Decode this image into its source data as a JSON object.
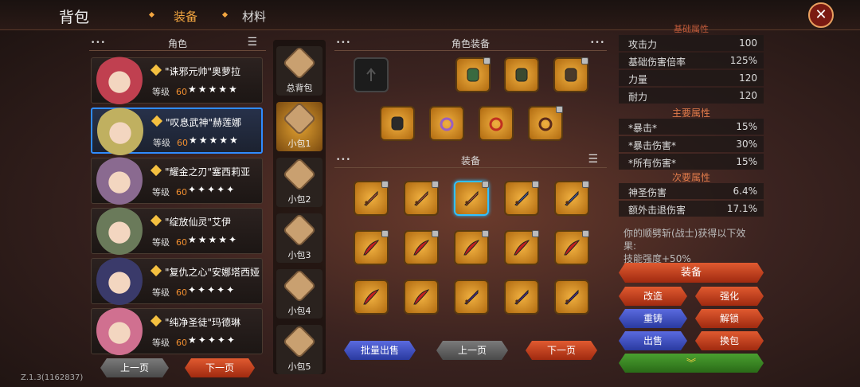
{
  "header": {
    "title": "背包",
    "tabs": [
      "装备",
      "材料"
    ]
  },
  "characters_header": "角色",
  "characters": [
    {
      "name": "\"诛邪元帅\"奥萝拉",
      "level_label": "等级",
      "level": "60",
      "stars": "★★★★★",
      "hue": "#c04050"
    },
    {
      "name": "\"叹息武神\"赫莲娜",
      "level_label": "等级",
      "level": "60",
      "stars": "★★★★★",
      "hue": "#c0b060"
    },
    {
      "name": "\"耀金之刃\"塞西莉亚",
      "level_label": "等级",
      "level": "60",
      "stars": "✦✦✦✦✦",
      "hue": "#8a6a90"
    },
    {
      "name": "\"绽放仙灵\"艾伊",
      "level_label": "等级",
      "level": "60",
      "stars": "★★★★✦",
      "hue": "#6a7a5a"
    },
    {
      "name": "\"复仇之心\"安娜塔西娅",
      "level_label": "等级",
      "level": "60",
      "stars": "✦✦✦✦✦",
      "hue": "#3a3a6a"
    },
    {
      "name": "\"纯净圣徒\"玛德琳",
      "level_label": "等级",
      "level": "60",
      "stars": "★✦✦✦✦",
      "hue": "#d07090"
    }
  ],
  "char_nav": {
    "prev": "上一页",
    "next": "下一页"
  },
  "bags": [
    "总背包",
    "小包1",
    "小包2",
    "小包3",
    "小包4",
    "小包5"
  ],
  "equip_section": "角色装备",
  "items_section": "装备",
  "items_nav": {
    "batch_sell": "批量出售",
    "prev": "上一页",
    "next": "下一页"
  },
  "stats": {
    "base_header": "基础属性",
    "base": [
      {
        "k": "攻击力",
        "v": "100"
      },
      {
        "k": "基础伤害倍率",
        "v": "125%"
      },
      {
        "k": "力量",
        "v": "120"
      },
      {
        "k": "耐力",
        "v": "120"
      }
    ],
    "main_header": "主要属性",
    "main": [
      {
        "k": "*暴击*",
        "v": "15%"
      },
      {
        "k": "*暴击伤害*",
        "v": "30%"
      },
      {
        "k": "*所有伤害*",
        "v": "15%"
      }
    ],
    "sub_header": "次要属性",
    "sub": [
      {
        "k": "神圣伤害",
        "v": "6.4%"
      },
      {
        "k": "额外击退伤害",
        "v": "17.1%"
      }
    ],
    "effect_line1": "你的顺劈斩(战士)获得以下效",
    "effect_line2": "果:",
    "effect_line3": "技能强度+50%"
  },
  "actions": {
    "equip": "装备",
    "upgrade": "改造",
    "enhance": "强化",
    "recast": "重铸",
    "unlock": "解锁",
    "sell": "出售",
    "swap": "换包"
  },
  "version": "Z.1.3(1162837)",
  "colors": {
    "accent": "#f3a640",
    "select_blue": "#2f8bff"
  }
}
